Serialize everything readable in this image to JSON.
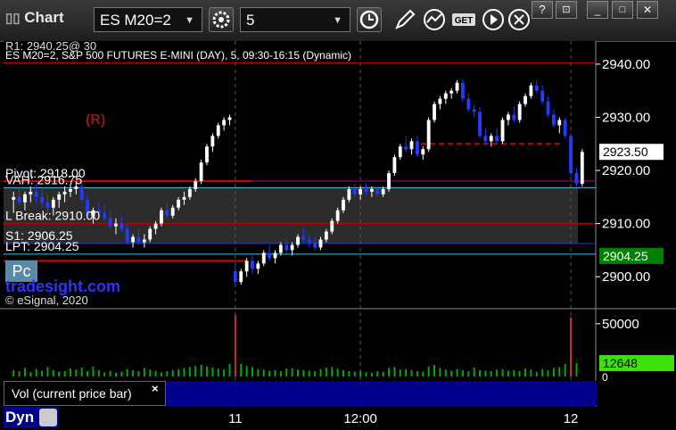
{
  "window": {
    "title": "Chart"
  },
  "toolbar": {
    "symbol": "ES M20=2",
    "interval": "5",
    "icons": [
      "settings-gear-icon",
      "clock-icon",
      "pencil-icon",
      "study-icon",
      "get-icon",
      "play-icon",
      "cursor-icon"
    ]
  },
  "legend": {
    "symbol_line": "ES M20=2, S&P 500 FUTURES E-MINI (DAY), 5, 09:30-16:15 (Dynamic)",
    "r1_line": "R1: 2940.25@ 30",
    "r_marker": "(R)",
    "pivot": "Pivot: 2918.00",
    "lbreak": "L Break: 2910.00",
    "s1": "S1: 2906.25",
    "lpt": "LPT: 2904.25",
    "vah": "VAH: 2916.75",
    "pc_label": "Pc",
    "brand": "tradesight.com",
    "copyright": "© eSignal, 2020"
  },
  "price_axis": {
    "ticks": [
      "2940.00",
      "2930.00",
      "2920.00",
      "2910.00",
      "2900.00"
    ],
    "current_price": "2923.50",
    "lpt_tag": "2904.25"
  },
  "volume_axis": {
    "tick": "50000",
    "zero": "0",
    "current_volume": "12648"
  },
  "time_axis": {
    "ticks": [
      "11",
      "12:00",
      "12"
    ]
  },
  "bottom": {
    "vol_study": "Vol (current price bar)",
    "close_x": "×",
    "mode": "Dyn"
  },
  "colors": {
    "up": "#ffffff",
    "down": "#1f3cff",
    "level_red": "#d00000",
    "level_blue": "#2030ff",
    "green": "#00c000",
    "volume": "#00b000"
  },
  "chart_data": {
    "type": "candlestick",
    "y_range": [
      2895,
      2942
    ],
    "levels": [
      {
        "name": "R1",
        "value": 2940.25
      },
      {
        "name": "Pivot",
        "value": 2918.0
      },
      {
        "name": "VAH",
        "value": 2916.75
      },
      {
        "name": "L Break",
        "value": 2910.0
      },
      {
        "name": "S1",
        "value": 2906.25
      },
      {
        "name": "LPT",
        "value": 2904.25
      }
    ],
    "candles": [
      [
        2914.5,
        2916,
        2912,
        2915
      ],
      [
        2915,
        2917,
        2913.5,
        2914
      ],
      [
        2914,
        2916,
        2912.5,
        2915.5
      ],
      [
        2915.5,
        2917,
        2914,
        2916
      ],
      [
        2916,
        2917.5,
        2914,
        2915
      ],
      [
        2915,
        2916.5,
        2913,
        2914
      ],
      [
        2914,
        2915.5,
        2912,
        2913
      ],
      [
        2913,
        2915,
        2911.5,
        2914.5
      ],
      [
        2914.5,
        2916,
        2913,
        2915.5
      ],
      [
        2915.5,
        2917,
        2914,
        2916
      ],
      [
        2916,
        2917.5,
        2915,
        2916.5
      ],
      [
        2916.5,
        2918,
        2915.5,
        2917
      ],
      [
        2917,
        2918,
        2914,
        2914.5
      ],
      [
        2914.5,
        2915.5,
        2911,
        2911.5
      ],
      [
        2911.5,
        2913,
        2910,
        2912.5
      ],
      [
        2912.5,
        2914,
        2911,
        2912
      ],
      [
        2912,
        2913.5,
        2910.5,
        2911
      ],
      [
        2911,
        2912.5,
        2909,
        2909.5
      ],
      [
        2909.5,
        2911,
        2908,
        2910
      ],
      [
        2910,
        2911.5,
        2908.5,
        2909
      ],
      [
        2909,
        2910,
        2906,
        2906.5
      ],
      [
        2906.5,
        2908,
        2905.5,
        2907.5
      ],
      [
        2907.5,
        2909,
        2906,
        2906.5
      ],
      [
        2906.5,
        2908,
        2905.5,
        2907
      ],
      [
        2907,
        2909.5,
        2906.5,
        2909
      ],
      [
        2909,
        2910.5,
        2908,
        2910
      ],
      [
        2910,
        2913,
        2909.5,
        2912.5
      ],
      [
        2912.5,
        2914,
        2911,
        2911.5
      ],
      [
        2911.5,
        2913.5,
        2911,
        2913
      ],
      [
        2913,
        2915,
        2912.5,
        2914.5
      ],
      [
        2914.5,
        2916,
        2913.5,
        2915
      ],
      [
        2915,
        2917,
        2914.5,
        2916.5
      ],
      [
        2916.5,
        2918.5,
        2916,
        2918
      ],
      [
        2918,
        2922,
        2917.5,
        2921.5
      ],
      [
        2921.5,
        2925,
        2921,
        2924.5
      ],
      [
        2924.5,
        2927,
        2923.5,
        2926.5
      ],
      [
        2926.5,
        2929,
        2926,
        2928.5
      ],
      [
        2928.5,
        2930,
        2927.5,
        2929.5
      ],
      [
        2929.5,
        2930.5,
        2928.5,
        2930
      ],
      [
        2901,
        2903,
        2898,
        2899
      ],
      [
        2899,
        2901.5,
        2898.5,
        2901
      ],
      [
        2901,
        2903.5,
        2900,
        2903
      ],
      [
        2903,
        2904,
        2900.5,
        2901.5
      ],
      [
        2901.5,
        2903,
        2900.5,
        2902.5
      ],
      [
        2902.5,
        2905,
        2902,
        2904.5
      ],
      [
        2904.5,
        2906,
        2903,
        2903.5
      ],
      [
        2903.5,
        2905,
        2902.5,
        2904.5
      ],
      [
        2904.5,
        2906.5,
        2904,
        2906
      ],
      [
        2906,
        2907,
        2904.5,
        2905
      ],
      [
        2905,
        2906.5,
        2904,
        2906
      ],
      [
        2906,
        2908,
        2905.5,
        2907.5
      ],
      [
        2907.5,
        2909,
        2906.5,
        2907
      ],
      [
        2907,
        2908,
        2905.5,
        2906.5
      ],
      [
        2906.5,
        2907.5,
        2905,
        2905.5
      ],
      [
        2905.5,
        2907.5,
        2905,
        2907
      ],
      [
        2907,
        2909,
        2906.5,
        2908.5
      ],
      [
        2908.5,
        2911,
        2908,
        2910.5
      ],
      [
        2910.5,
        2913,
        2910,
        2912.5
      ],
      [
        2912.5,
        2915,
        2912,
        2914.5
      ],
      [
        2914.5,
        2917,
        2914,
        2916.5
      ],
      [
        2916.5,
        2917.5,
        2915,
        2915.5
      ],
      [
        2915.5,
        2917,
        2914.5,
        2916.5
      ],
      [
        2916.5,
        2917.5,
        2915.5,
        2916
      ],
      [
        2916,
        2917,
        2915,
        2916.5
      ],
      [
        2916.5,
        2917,
        2915,
        2915.5
      ],
      [
        2915.5,
        2917,
        2915,
        2916.5
      ],
      [
        2916.5,
        2920,
        2916,
        2919.5
      ],
      [
        2919.5,
        2923,
        2919,
        2922.5
      ],
      [
        2922.5,
        2925,
        2922,
        2924.5
      ],
      [
        2924.5,
        2926.5,
        2923.5,
        2924
      ],
      [
        2924,
        2926,
        2923,
        2925.5
      ],
      [
        2925.5,
        2926.5,
        2922.5,
        2923
      ],
      [
        2923,
        2924.5,
        2922,
        2924
      ],
      [
        2924,
        2930,
        2923.5,
        2929.5
      ],
      [
        2929.5,
        2933,
        2929,
        2932.5
      ],
      [
        2932.5,
        2934,
        2931.5,
        2933.5
      ],
      [
        2933.5,
        2935,
        2932.5,
        2934.5
      ],
      [
        2934.5,
        2935.5,
        2933.5,
        2935
      ],
      [
        2935,
        2937,
        2934.5,
        2936.5
      ],
      [
        2936.5,
        2937,
        2933,
        2933.5
      ],
      [
        2933.5,
        2934.5,
        2931,
        2931.5
      ],
      [
        2931.5,
        2932.5,
        2930,
        2931
      ],
      [
        2931,
        2932,
        2926,
        2926.5
      ],
      [
        2926.5,
        2928,
        2925,
        2925.5
      ],
      [
        2925.5,
        2927,
        2924.5,
        2926.5
      ],
      [
        2926.5,
        2928,
        2925,
        2925.5
      ],
      [
        2925.5,
        2930,
        2925,
        2929.5
      ],
      [
        2929.5,
        2931,
        2928.5,
        2930.5
      ],
      [
        2930.5,
        2932,
        2929,
        2929.5
      ],
      [
        2929.5,
        2933,
        2929,
        2932.5
      ],
      [
        2932.5,
        2934.5,
        2932,
        2934
      ],
      [
        2934,
        2936.5,
        2933.5,
        2936
      ],
      [
        2936,
        2937,
        2934.5,
        2935
      ],
      [
        2935,
        2936,
        2932.5,
        2933
      ],
      [
        2933,
        2934,
        2930,
        2930.5
      ],
      [
        2930.5,
        2931.5,
        2928,
        2928.5
      ],
      [
        2928.5,
        2930,
        2927,
        2929.5
      ],
      [
        2929.5,
        2930,
        2926,
        2926.5
      ],
      [
        2926.5,
        2927,
        2919,
        2919.5
      ],
      [
        2919.5,
        2920.5,
        2917,
        2917.5
      ],
      [
        2917.5,
        2924,
        2917,
        2923.5
      ]
    ],
    "volume_max": 60000,
    "volume": [
      6000,
      5000,
      8000,
      4000,
      7000,
      5500,
      9000,
      6000,
      4500,
      5000,
      7500,
      6500,
      8500,
      5000,
      9500,
      6000,
      4000,
      5500,
      3500,
      4500,
      7000,
      6000,
      5000,
      8000,
      6500,
      5500,
      4000,
      5000,
      6000,
      7000,
      8000,
      9000,
      10000,
      11000,
      9500,
      8500,
      7500,
      6500,
      12000,
      58000,
      12000,
      10000,
      9000,
      7000,
      6500,
      5500,
      6000,
      5000,
      7500,
      8000,
      6500,
      6000,
      5500,
      5000,
      7000,
      8500,
      9000,
      7500,
      6000,
      5000,
      4500,
      5500,
      4000,
      3500,
      5000,
      4500,
      8000,
      9000,
      6500,
      7000,
      6000,
      5000,
      4500,
      9500,
      11000,
      8000,
      6500,
      5500,
      7000,
      6000,
      5000,
      8500,
      6000,
      5500,
      5000,
      6500,
      7000,
      5500,
      6000,
      5000,
      7500,
      6500,
      4500,
      7000,
      6000,
      8000,
      9000,
      12000,
      56000,
      12648
    ],
    "time_ticks": [
      {
        "label": "11",
        "index": 39
      },
      {
        "label": "12:00",
        "index": 61
      },
      {
        "label": "12",
        "index": 98
      }
    ]
  }
}
